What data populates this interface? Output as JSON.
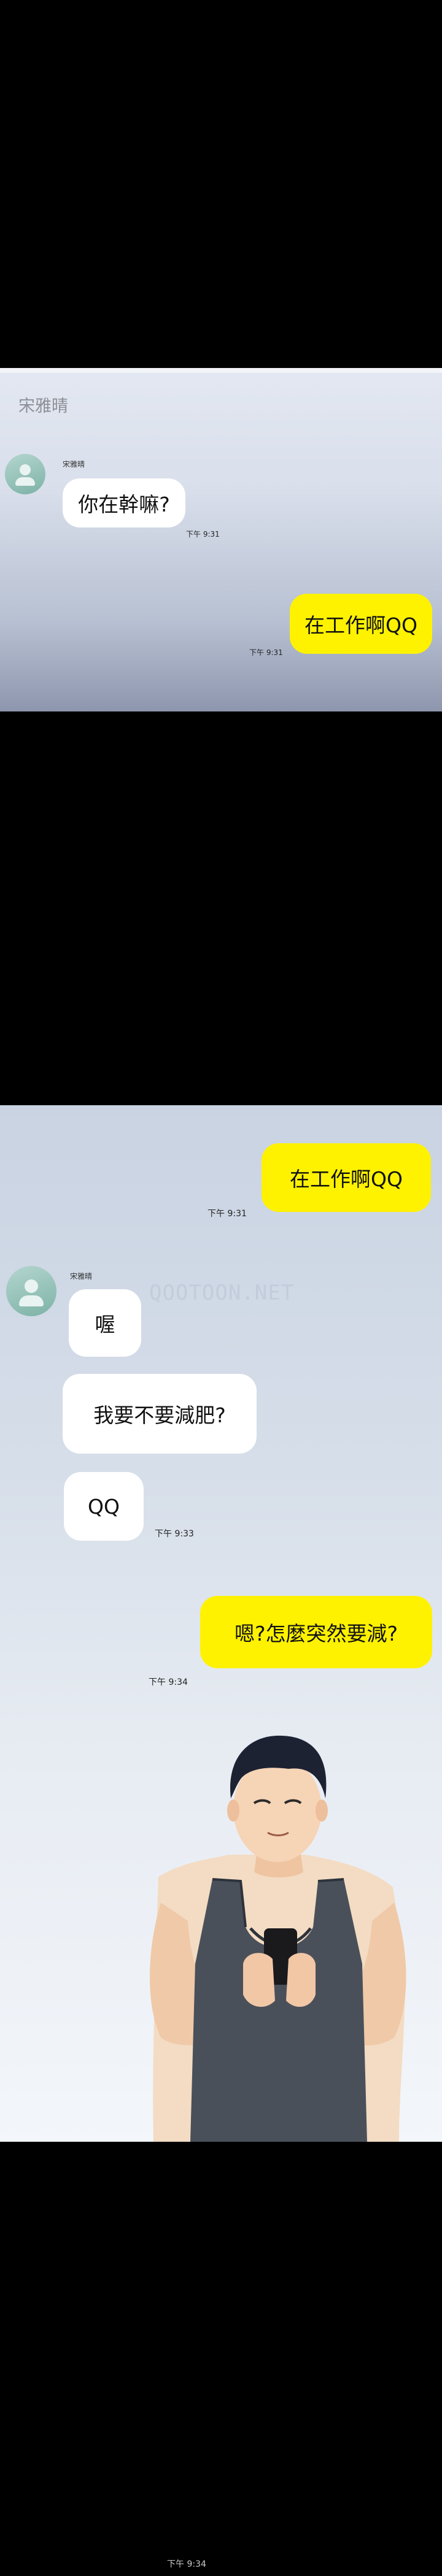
{
  "panel1": {
    "contact_name": "宋雅晴",
    "sender_label": "宋雅晴",
    "messages": [
      {
        "text": "你在幹嘛?",
        "time": "下午 9:31"
      },
      {
        "text": "在工作啊QQ",
        "time": "下午 9:31"
      }
    ]
  },
  "panel2": {
    "messages": [
      {
        "text": "在工作啊QQ",
        "time": "下午 9:31"
      },
      {
        "text": "喔"
      },
      {
        "text": "我要不要減肥?"
      },
      {
        "text": "QQ",
        "time": "下午 9:33"
      },
      {
        "text": "嗯?怎麼突然要減?",
        "time": "下午 9:34"
      }
    ],
    "sender_label": "宋雅晴",
    "watermark": "QOOTOON.NET"
  },
  "bottom_time": "下午 9:34",
  "colors": {
    "outgoing_bubble": "#fef200",
    "incoming_bubble": "#ffffff",
    "avatar": "#9cc7bd"
  },
  "icons": [
    "user-avatar-icon"
  ]
}
